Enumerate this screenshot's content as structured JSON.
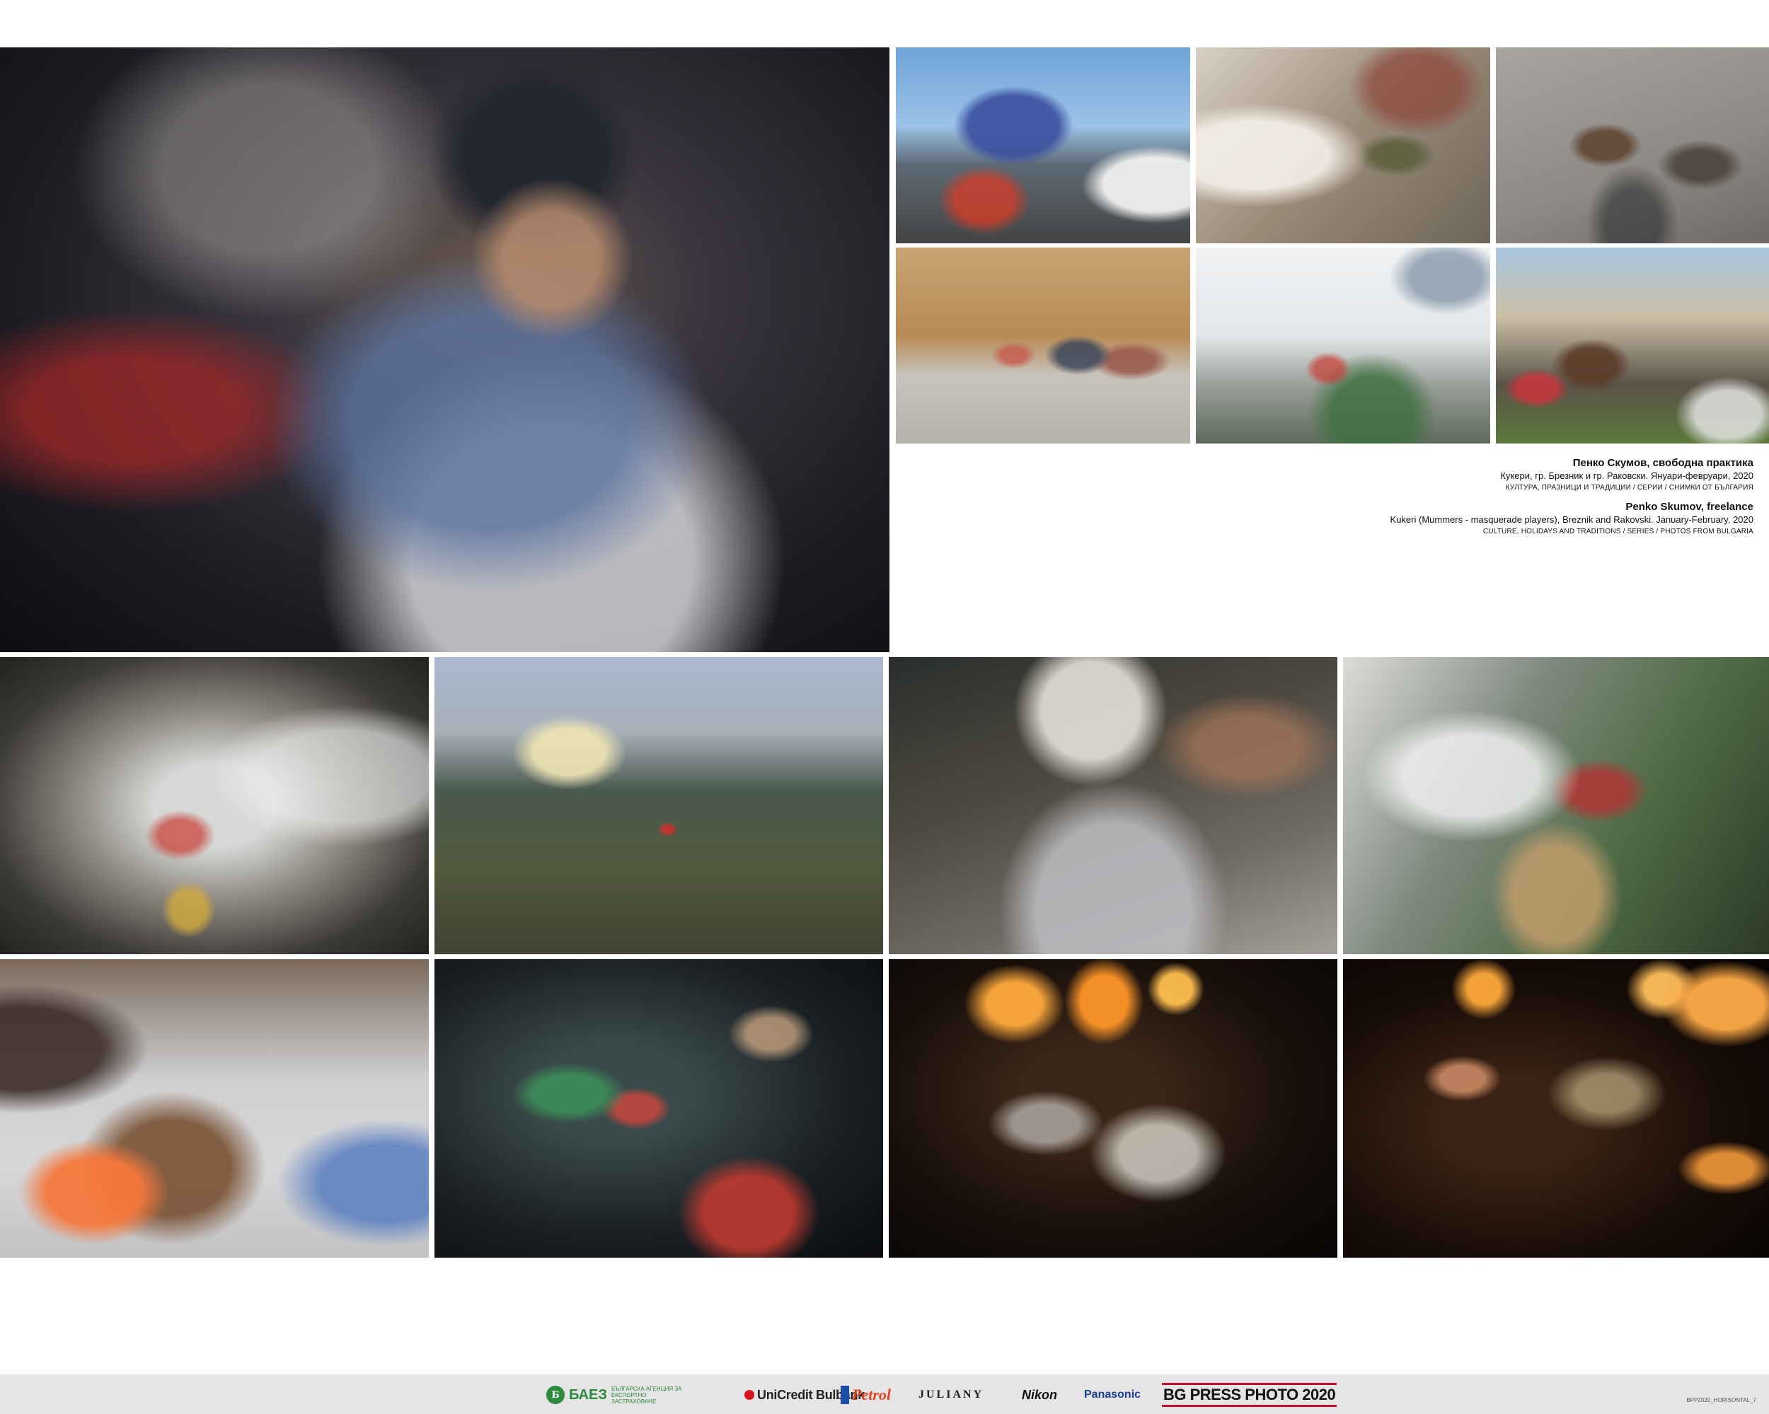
{
  "photos": {
    "main": "",
    "thumbs": []
  },
  "caption": {
    "bg_name": "Пенко Скумов, свободна практика",
    "bg_title": "Кукери, гр. Брезник и гр. Раковски. Януари-февруари, 2020",
    "bg_category": "КУЛТУРА, ПРАЗНИЦИ И ТРАДИЦИИ / СЕРИИ / СНИМКИ ОТ БЪЛГАРИЯ",
    "en_name": "Penko Skumov, freelance",
    "en_title": "Kukeri (Mummers - masquerade players), Breznik and Rakovski. January-February, 2020",
    "en_category": "CULTURE, HOLIDAYS AND TRADITIONS / SERIES / PHOTOS FROM BULGARIA"
  },
  "sponsors": {
    "baez_mark": "Б",
    "baez_name": "БАЕЗ",
    "baez_sub": "БЪЛГАРСКА АГЕНЦИЯ ЗА ЕКСПОРТНО ЗАСТРАХОВАНЕ",
    "unicredit": "UniCredit Bulbank",
    "petrol": "Petrol",
    "juliany": "JULIANY",
    "nikon": "Nikon",
    "panasonic": "Panasonic",
    "bgpp": "BG PRESS PHOTO 2020"
  },
  "page_id": "BPP2020_HORISONTAL_7",
  "colors": {
    "background": "#ffffff",
    "footer": "#e5e5e5",
    "baez_green": "#2e8a3c",
    "unicredit_red": "#d6141f",
    "bgpp_red": "#c8102e"
  }
}
